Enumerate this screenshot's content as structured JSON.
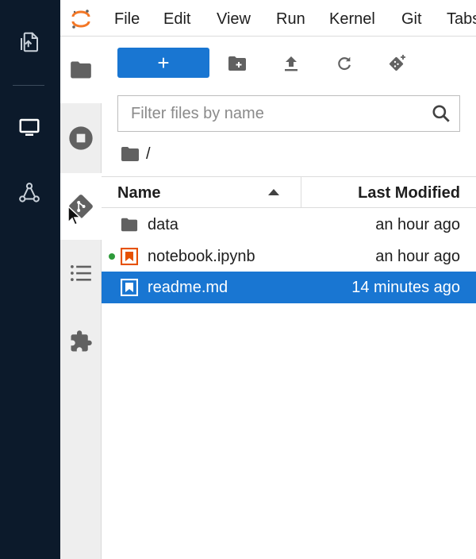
{
  "menubar": {
    "items": [
      "File",
      "Edit",
      "View",
      "Run",
      "Kernel",
      "Git",
      "Tabs"
    ]
  },
  "outer_rail": {
    "icons": [
      "file-upload-icon",
      "desktop-icon",
      "collaboration-icon"
    ]
  },
  "sidebar": {
    "tabs": [
      "folder-icon",
      "stop-circle-icon",
      "git-icon",
      "list-icon",
      "puzzle-icon"
    ],
    "active": "folder-icon"
  },
  "toolbar": {
    "new_label": "+",
    "icons": [
      "new-folder-icon",
      "upload-icon",
      "refresh-icon",
      "git-clone-icon"
    ]
  },
  "filter": {
    "placeholder": "Filter files by name"
  },
  "breadcrumb": {
    "path": "/"
  },
  "table": {
    "columns": {
      "name": "Name",
      "modified": "Last Modified"
    },
    "rows": [
      {
        "name": "data",
        "modified": "an hour ago",
        "icon": "folder-icon"
      },
      {
        "name": "notebook.ipynb",
        "modified": "an hour ago",
        "icon": "notebook-icon"
      },
      {
        "name": "readme.md",
        "modified": "14 minutes ago",
        "icon": "markdown-icon"
      }
    ]
  },
  "colors": {
    "accent": "#1976d2",
    "rail": "#0c1a2b",
    "running": "#2e9a3a",
    "notebook": "#e65100"
  }
}
